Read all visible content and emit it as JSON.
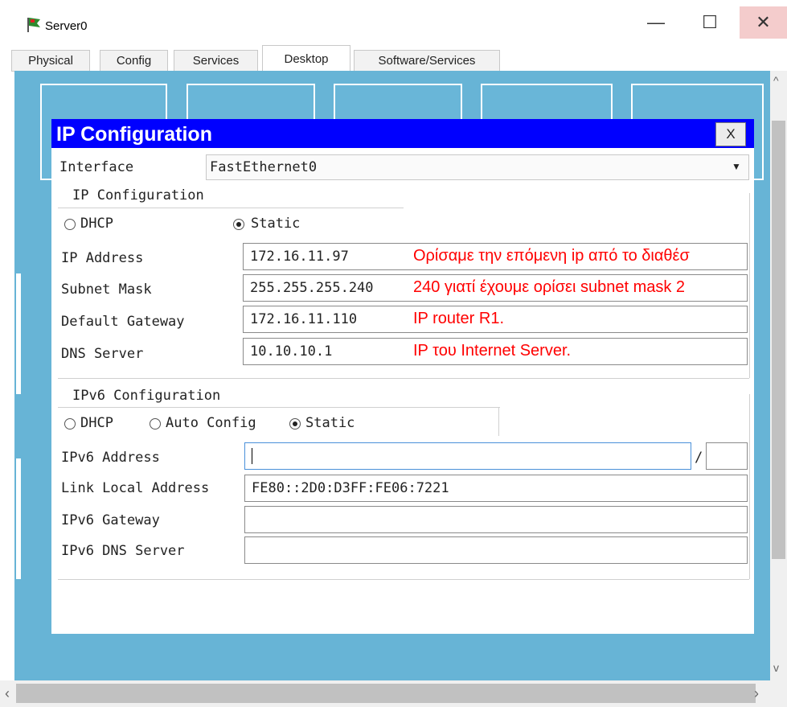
{
  "window": {
    "title": "Server0",
    "minimize_glyph": "—",
    "maximize_glyph": "☐",
    "close_glyph": "✕"
  },
  "tabs": [
    "Physical",
    "Config",
    "Services",
    "Desktop",
    "Software/Services"
  ],
  "active_tab": "Desktop",
  "dialog": {
    "title": "IP Configuration",
    "close_label": "X",
    "interface_label": "Interface",
    "interface_value": "FastEthernet0",
    "ipv4": {
      "group_label": "IP Configuration",
      "dhcp_label": "DHCP",
      "static_label": "Static",
      "selected": "Static",
      "fields": [
        {
          "label": "IP Address",
          "value": "172.16.11.97",
          "note": "Ορίσαμε την επόμενη ip από το διαθέσ"
        },
        {
          "label": "Subnet Mask",
          "value": "255.255.255.240",
          "note": "240 γιατί έχουμε ορίσει subnet mask 2"
        },
        {
          "label": "Default Gateway",
          "value": "172.16.11.110",
          "note": "IP router R1."
        },
        {
          "label": "DNS Server",
          "value": "10.10.10.1",
          "note": "IP του Internet Server."
        }
      ]
    },
    "ipv6": {
      "group_label": "IPv6 Configuration",
      "dhcp_label": "DHCP",
      "auto_label": "Auto Config",
      "static_label": "Static",
      "selected": "Static",
      "address_label": "IPv6 Address",
      "address_value": "",
      "prefix_separator": "/",
      "prefix_value": "",
      "link_local_label": "Link Local Address",
      "link_local_value": "FE80::2D0:D3FF:FE06:7221",
      "gateway_label": "IPv6 Gateway",
      "gateway_value": "",
      "dns_label": "IPv6 DNS Server",
      "dns_value": ""
    }
  },
  "colors": {
    "desktop_bg": "#67b4d6",
    "dialog_header": "#0000ff",
    "annotation": "#ff0000"
  }
}
